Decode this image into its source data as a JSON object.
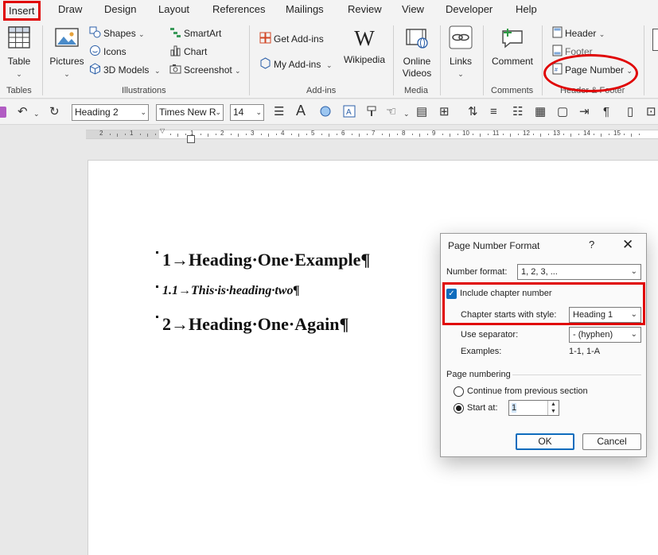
{
  "tabs": [
    "Insert",
    "Draw",
    "Design",
    "Layout",
    "References",
    "Mailings",
    "Review",
    "View",
    "Developer",
    "Help"
  ],
  "ribbon": {
    "tables": {
      "table_label": "Table",
      "group": "Tables"
    },
    "illustrations": {
      "pictures_label": "Pictures",
      "shapes_label": "Shapes",
      "icons_label": "Icons",
      "models_label": "3D Models",
      "smartart_label": "SmartArt",
      "chart_label": "Chart",
      "screenshot_label": "Screenshot",
      "group": "Illustrations"
    },
    "addins": {
      "get_label": "Get Add-ins",
      "my_label": "My Add-ins",
      "wikipedia_label": "Wikipedia",
      "group": "Add-ins"
    },
    "media": {
      "video_label_1": "Online",
      "video_label_2": "Videos",
      "group": "Media"
    },
    "links": {
      "links_label": "Links"
    },
    "comments": {
      "comment_label": "Comment",
      "group": "Comments"
    },
    "header_footer": {
      "header_label": "Header",
      "footer_label": "Footer",
      "page_number_label": "Page Number",
      "group": "Header & Footer"
    }
  },
  "qat": {
    "style": "Heading 2",
    "font": "Times New R",
    "size": "14"
  },
  "ruler": {
    "ticks": [
      "2",
      "1",
      "",
      "1",
      "2",
      "3",
      "4",
      "5",
      "6",
      "7",
      "8",
      "9",
      "10",
      "11",
      "12",
      "13",
      "14",
      "15"
    ]
  },
  "document": {
    "para1": "1→Heading·One·Example¶",
    "para2": "1.1→This·is·heading·two¶",
    "para3": "2→Heading·One·Again¶"
  },
  "dialog": {
    "title": "Page Number Format",
    "help": "?",
    "close": "✕",
    "number_format_label": "Number format:",
    "number_format_value": "1, 2, 3, ...",
    "include_chapter_label": "Include chapter number",
    "include_chapter_checked": true,
    "chapter_style_label": "Chapter starts with style:",
    "chapter_style_value": "Heading 1",
    "separator_label": "Use separator:",
    "separator_value": "-   (hyphen)",
    "examples_label": "Examples:",
    "examples_value": "1-1, 1-A",
    "page_numbering_label": "Page numbering",
    "continue_label": "Continue from previous section",
    "start_at_label": "Start at:",
    "start_at_value": "1",
    "ok_label": "OK",
    "cancel_label": "Cancel"
  },
  "colors": {
    "highlight": "#e00000",
    "accent": "#0f6cbd"
  }
}
